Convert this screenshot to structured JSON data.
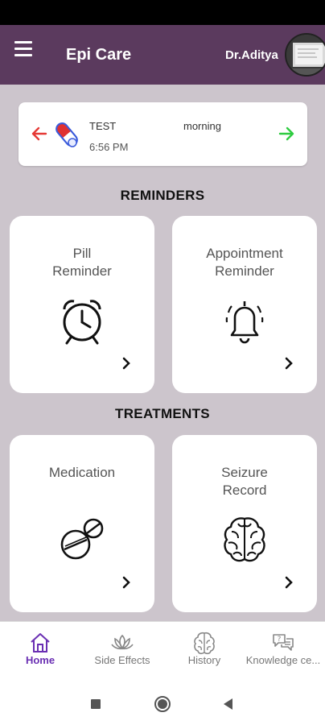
{
  "app": {
    "title": "Epi Care",
    "user_name": "Dr.Aditya"
  },
  "reminder": {
    "name": "TEST",
    "time": "6:56 PM",
    "period": "morning"
  },
  "sections": {
    "reminders": "REMINDERS",
    "treatments": "TREATMENTS"
  },
  "tiles": {
    "pill_reminder": "Pill\nReminder",
    "appointment_reminder": "Appointment\nReminder",
    "medication": "Medication",
    "seizure_record": "Seizure\nRecord"
  },
  "nav": {
    "items": [
      {
        "label": "Home",
        "icon": "home-icon",
        "active": true
      },
      {
        "label": "Side Effects",
        "icon": "lotus-icon",
        "active": false
      },
      {
        "label": "History",
        "icon": "brain-icon",
        "active": false
      },
      {
        "label": "Knowledge ce...",
        "icon": "chat-question-icon",
        "active": false
      }
    ]
  },
  "colors": {
    "app_bar": "#5b3a5e",
    "background": "#ccc5cc",
    "active_nav": "#6a2fb3",
    "arrow_left": "#e53935",
    "arrow_right": "#2ecc40"
  }
}
